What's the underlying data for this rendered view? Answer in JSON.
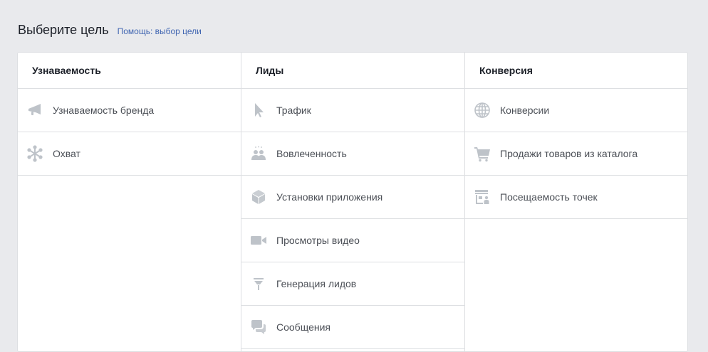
{
  "header": {
    "title": "Выберите цель",
    "help_link": "Помощь: выбор цели"
  },
  "colors": {
    "background": "#e9eaed",
    "panel": "#ffffff",
    "border": "#dddfe2",
    "link": "#4267b2",
    "icon": "#bec3c9",
    "text": "#4b4f56",
    "heading": "#1d2129"
  },
  "columns": [
    {
      "title": "Узнаваемость",
      "items": [
        {
          "label": "Узнаваемость бренда",
          "icon": "megaphone-icon"
        },
        {
          "label": "Охват",
          "icon": "reach-icon"
        }
      ]
    },
    {
      "title": "Лиды",
      "items": [
        {
          "label": "Трафик",
          "icon": "cursor-icon"
        },
        {
          "label": "Вовлеченность",
          "icon": "people-icon"
        },
        {
          "label": "Установки приложения",
          "icon": "cube-icon"
        },
        {
          "label": "Просмотры видео",
          "icon": "video-icon"
        },
        {
          "label": "Генерация лидов",
          "icon": "funnel-icon"
        },
        {
          "label": "Сообщения",
          "icon": "chat-icon"
        }
      ]
    },
    {
      "title": "Конверсия",
      "items": [
        {
          "label": "Конверсии",
          "icon": "globe-icon"
        },
        {
          "label": "Продажи товаров из каталога",
          "icon": "cart-icon"
        },
        {
          "label": "Посещаемость точек",
          "icon": "store-icon"
        }
      ]
    }
  ]
}
